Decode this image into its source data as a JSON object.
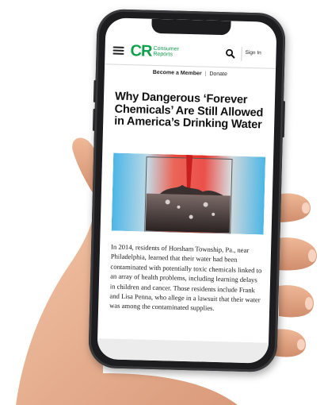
{
  "header": {
    "logo_mark": "CR",
    "logo_line1": "Consumer",
    "logo_line2": "Reports",
    "sign_in": "Sign In"
  },
  "member_bar": {
    "become_member": "Become a Member",
    "separator": "|",
    "donate": "Donate"
  },
  "article": {
    "headline": "Why Dangerous ‘Forever Chemicals’ Are Still Allowed in America’s Drinking Water",
    "body": "In 2014, residents of Horsham Township, Pa., near Philadelphia, learned that their water had been contaminated with potentially toxic chemicals linked to an array of health problems, including learning delays in children and cancer. Those residents include Frank and Lisa Penna, who allege in a lawsuit that their water was among the contaminated supplies."
  },
  "colors": {
    "brand_green": "#0fa14b",
    "hero_red": "#e8322a",
    "hero_blue": "#4bb6e6"
  },
  "icons": {
    "menu": "hamburger-menu-icon",
    "search": "search-icon"
  }
}
